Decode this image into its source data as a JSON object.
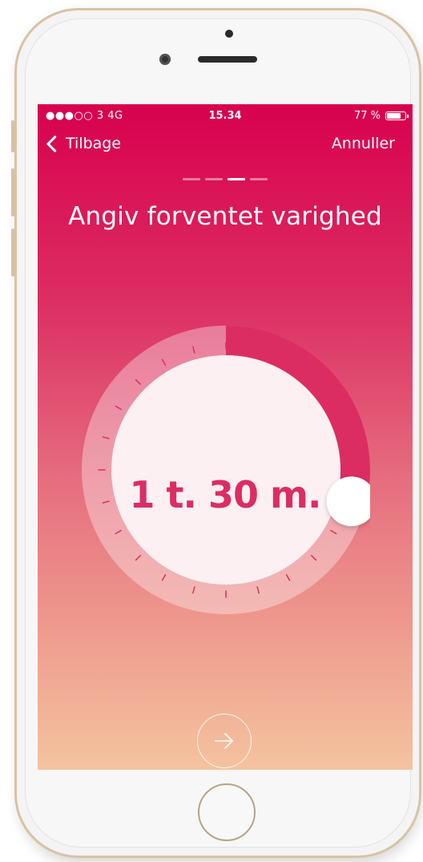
{
  "status_bar": {
    "carrier": "●●●○○ 3  4G",
    "time": "15.34",
    "battery_percent_label": "77 %",
    "battery_level": 0.77
  },
  "nav": {
    "back_label": "Tilbage",
    "cancel_label": "Annuller"
  },
  "steps": {
    "total": 4,
    "active_index": 2
  },
  "title": "Angiv forventet varighed",
  "duration": {
    "display": "1 t. 30 m.",
    "fraction_of_dial": 0.27
  },
  "icons": {
    "next": "arrow-right-icon",
    "back": "chevron-left-icon",
    "battery": "battery-icon"
  },
  "colors": {
    "accent": "#dc2d63",
    "gradient_top": "#d8004e",
    "gradient_bottom": "#f4c39f"
  }
}
